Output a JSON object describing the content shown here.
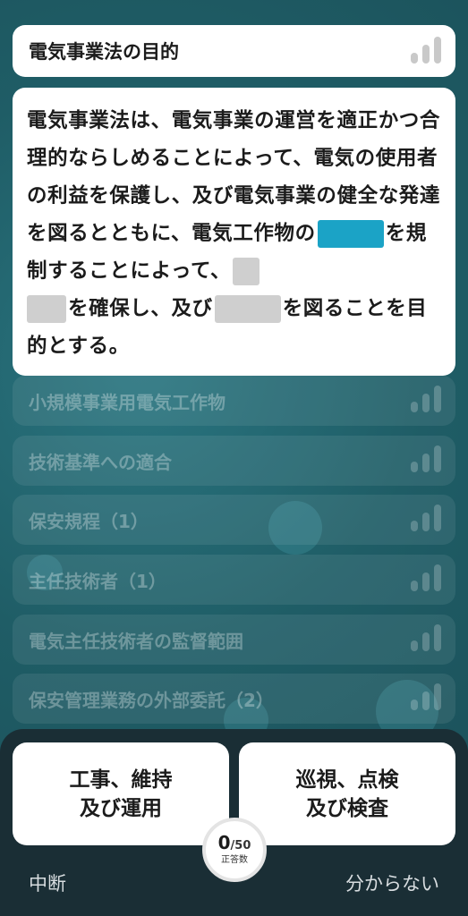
{
  "header": {
    "title": "電気事業法の目的"
  },
  "question": {
    "segments": [
      {
        "type": "text",
        "value": "電気事業法は、電気事業の運営を適正かつ合理的ならしめることによって、電気の使用者の利益を保護し、及び電気事業の健全な発達を図るとともに、電気工作物の"
      },
      {
        "type": "blank",
        "state": "active"
      },
      {
        "type": "text",
        "value": "を規制することによって、"
      },
      {
        "type": "blank",
        "state": "inactive"
      },
      {
        "type": "text",
        "value": "を確保し、及び"
      },
      {
        "type": "blank",
        "state": "inactive"
      },
      {
        "type": "text",
        "value": "を図ることを目的とする。"
      }
    ]
  },
  "topics": [
    {
      "label": "小規模事業用電気工作物"
    },
    {
      "label": "技術基準への適合"
    },
    {
      "label": "保安規程（1）"
    },
    {
      "label": "主任技術者（1）"
    },
    {
      "label": "電気主任技術者の監督範囲"
    },
    {
      "label": "保安管理業務の外部委託（2）"
    }
  ],
  "answers": {
    "left": {
      "line1": "工事、維持",
      "line2": "及び運用"
    },
    "right": {
      "line1": "巡視、点検",
      "line2": "及び検査"
    }
  },
  "score": {
    "current": "0",
    "total": "/50",
    "caption": "正答数"
  },
  "footer": {
    "interrupt_label": "中断",
    "dont_know_label": "分からない"
  },
  "colors": {
    "background": "#1f5d66",
    "active_blank": "#1ba3c6",
    "inactive_blank": "#cfcfcf",
    "bottom_panel": "#1a2e35"
  },
  "icons": {
    "signal": "signal-strength-icon"
  }
}
